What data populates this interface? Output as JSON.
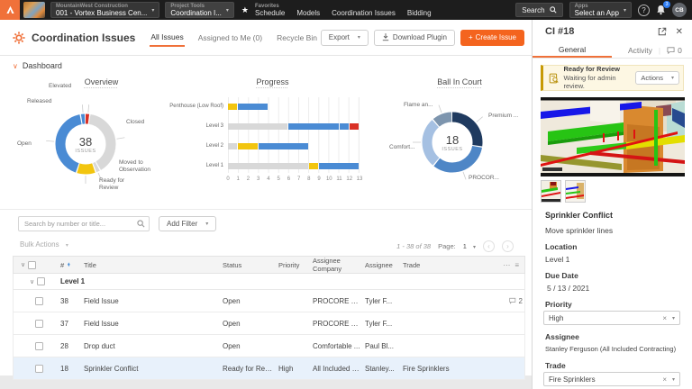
{
  "topbar": {
    "project_label": "MountainWest Construction",
    "project_value": "001 - Vortex Business Cen...",
    "tools_label": "Project Tools",
    "tools_value": "Coordination I...",
    "favorites_label": "Favorites",
    "nav_items": [
      "Schedule",
      "Models",
      "Coordination Issues",
      "Bidding"
    ],
    "search_label": "Search",
    "apps_label": "Apps",
    "apps_value": "Select an App",
    "help_glyph": "?",
    "notification_count": "3",
    "avatar_initials": "CB"
  },
  "header": {
    "title": "Coordination Issues",
    "tabs": [
      {
        "label": "All Issues",
        "active": true
      },
      {
        "label": "Assigned to Me (0)",
        "active": false
      },
      {
        "label": "Recycle Bin",
        "active": false
      }
    ],
    "export_label": "Export",
    "download_label": "Download Plugin",
    "create_label": "Create Issue",
    "dashboard_label": "Dashboard"
  },
  "chart_data": [
    {
      "type": "pie",
      "title": "Overview",
      "center_value": "38",
      "center_label": "ISSUES",
      "legend_position": "callout-labels",
      "slices": [
        {
          "label": "Elevated",
          "value": 1,
          "color": "#d93025"
        },
        {
          "label": "Closed",
          "value": 15,
          "color": "#d8d8d8"
        },
        {
          "label": "Moved to Observation",
          "value": 1,
          "color": "#d8d8d8"
        },
        {
          "label": "Ready for Review",
          "value": 4,
          "color": "#f2c50f"
        },
        {
          "label": "Open",
          "value": 16,
          "color": "#4a8bd4"
        },
        {
          "label": "Released",
          "value": 1,
          "color": "#4a8bd4"
        }
      ]
    },
    {
      "type": "bar",
      "title": "Progress",
      "orientation": "horizontal",
      "stacked": true,
      "grid": true,
      "categories": [
        "Penthouse (Low Roof)",
        "Level 3",
        "Level 2",
        "Level 1"
      ],
      "series": [
        {
          "name": "Closed",
          "color": "#d8d8d8",
          "values": [
            0,
            6,
            1,
            8
          ]
        },
        {
          "name": "Ready for Review",
          "color": "#f2c50f",
          "values": [
            1,
            0,
            2,
            1
          ]
        },
        {
          "name": "Open",
          "color": "#4a8bd4",
          "values": [
            3,
            5,
            5,
            4
          ]
        },
        {
          "name": "Released",
          "color": "#4a8bd4",
          "values": [
            0,
            1,
            0,
            0
          ]
        },
        {
          "name": "Elevated",
          "color": "#d93025",
          "values": [
            0,
            1,
            0,
            0
          ]
        }
      ],
      "xlim": [
        0,
        13
      ],
      "xticks": [
        0,
        1,
        2,
        3,
        4,
        5,
        6,
        7,
        8,
        9,
        10,
        11,
        12,
        13
      ],
      "xlabel": "",
      "ylabel": ""
    },
    {
      "type": "pie",
      "title": "Ball In Court",
      "center_value": "18",
      "center_label": "ISSUES",
      "legend_position": "callout-labels",
      "slices": [
        {
          "label": "Premium ...",
          "value": 5,
          "color": "#1f3a5f"
        },
        {
          "label": "PROCOR...",
          "value": 6,
          "color": "#4e86c6"
        },
        {
          "label": "Comfort...",
          "value": 5,
          "color": "#a5c0e2"
        },
        {
          "label": "Flame an...",
          "value": 2,
          "color": "#7d95ae"
        }
      ]
    }
  ],
  "filters": {
    "search_placeholder": "Search by number or title...",
    "add_filter_label": "Add Filter",
    "bulk_actions_label": "Bulk Actions"
  },
  "pagination": {
    "range": "1 - 38 of 38",
    "page_label": "Page:",
    "page": "1"
  },
  "table": {
    "columns": [
      "#",
      "Title",
      "Status",
      "Priority",
      "Assignee Company",
      "Assignee",
      "Trade"
    ],
    "group_label": "Level 1",
    "rows": [
      {
        "num": "38",
        "title": "Field Issue",
        "status": "Open",
        "priority": "",
        "company": "PROCORE Te...",
        "assignee": "Tyler F...",
        "trade": "",
        "comments": "2",
        "selected": false
      },
      {
        "num": "37",
        "title": "Field Issue",
        "status": "Open",
        "priority": "",
        "company": "PROCORE Te...",
        "assignee": "Tyler F...",
        "trade": "",
        "comments": "",
        "selected": false
      },
      {
        "num": "28",
        "title": "Drop duct",
        "status": "Open",
        "priority": "",
        "company": "Comfortable ...",
        "assignee": "Paul Bl...",
        "trade": "",
        "comments": "",
        "selected": false
      },
      {
        "num": "18",
        "title": "Sprinkler Conflict",
        "status": "Ready for Review",
        "priority": "High",
        "company": "All Included C...",
        "assignee": "Stanley...",
        "trade": "Fire Sprinklers",
        "comments": "",
        "selected": true
      }
    ]
  },
  "panel": {
    "title": "CI #18",
    "tab_general": "General",
    "tab_activity": "Activity",
    "comment_count": "0",
    "banner": {
      "title": "Ready for Review",
      "subtitle": "Waiting for admin review.",
      "action_label": "Actions"
    },
    "issue": {
      "title": "Sprinkler Conflict",
      "description": "Move sprinkler lines",
      "location_label": "Location",
      "location": "Level 1",
      "due_label": "Due Date",
      "due": "5 / 13 / 2021",
      "priority_label": "Priority",
      "priority": "High",
      "assignee_label": "Assignee",
      "assignee": "Stanley Ferguson (All Included Contracting)",
      "trade_label": "Trade",
      "trade": "Fire Sprinklers"
    }
  }
}
